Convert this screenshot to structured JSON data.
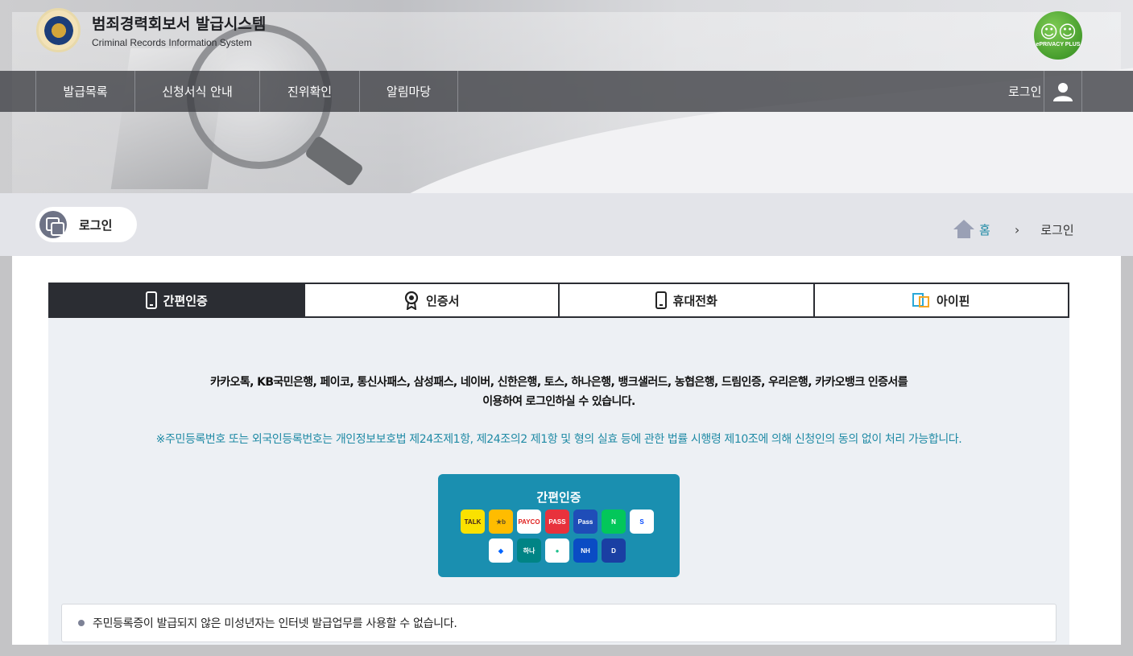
{
  "header": {
    "title": "범죄경력회보서 발급시스템",
    "subtitle": "Criminal Records Information System",
    "eprivacy_label": "ePRIVACY PLUS"
  },
  "nav": {
    "items": [
      {
        "label": "발급목록"
      },
      {
        "label": "신청서식 안내"
      },
      {
        "label": "진위확인"
      },
      {
        "label": "알림마당"
      }
    ],
    "login_label": "로그인"
  },
  "page": {
    "badge_label": "로그인",
    "breadcrumb": {
      "home": "홈",
      "current": "로그인"
    }
  },
  "tabs": [
    {
      "label": "간편인증",
      "icon": "phone-icon",
      "active": true
    },
    {
      "label": "인증서",
      "icon": "certificate-icon",
      "active": false
    },
    {
      "label": "휴대전화",
      "icon": "mobile-phone-icon",
      "active": false
    },
    {
      "label": "아이핀",
      "icon": "ipin-icon",
      "active": false
    }
  ],
  "content": {
    "desc_line1": "카카오톡, KB국민은행, 페이코, 통신사패스, 삼성패스, 네이버, 신한은행, 토스, 하나은행, 뱅크샐러드, 농협은행, 드림인증, 우리은행, 카카오뱅크 인증서를",
    "desc_line2": "이용하여 로그인하실 수 있습니다.",
    "notice": "※주민등록번호 또는 외국인등록번호는 개인정보보호법 제24조제1항, 제24조의2 제1항 및 형의 실효 등에 관한 법률 시행령 제10조에 의해 신청인의 동의 없이 처리 가능합니다.",
    "easy_auth_button": "간편인증",
    "providers_row1": [
      {
        "name": "kakaotalk-icon",
        "text": "TALK",
        "bg": "#fae100",
        "fg": "#3c1e1e"
      },
      {
        "name": "kb-bank-icon",
        "text": "★b",
        "bg": "#ffbc00",
        "fg": "#5a4a2a"
      },
      {
        "name": "payco-icon",
        "text": "PAYCO",
        "bg": "#ffffff",
        "fg": "#e0201f"
      },
      {
        "name": "pass-icon",
        "text": "PASS",
        "bg": "#e8323c",
        "fg": "#ffffff"
      },
      {
        "name": "samsung-pass-icon",
        "text": "Pass",
        "bg": "#1f4db8",
        "fg": "#ffffff"
      },
      {
        "name": "naver-icon",
        "text": "N",
        "bg": "#03c75a",
        "fg": "#ffffff"
      },
      {
        "name": "shinhan-bank-icon",
        "text": "S",
        "bg": "#ffffff",
        "fg": "#0046ff"
      }
    ],
    "providers_row2": [
      {
        "name": "toss-icon",
        "text": "◆",
        "bg": "#ffffff",
        "fg": "#0064ff"
      },
      {
        "name": "hana-bank-icon",
        "text": "하나",
        "bg": "#008485",
        "fg": "#ffffff"
      },
      {
        "name": "banksalad-icon",
        "text": "●",
        "bg": "#ffffff",
        "fg": "#1fc18e"
      },
      {
        "name": "nh-bank-icon",
        "text": "NH",
        "bg": "#0a4cc4",
        "fg": "#ffffff"
      },
      {
        "name": "dream-cert-icon",
        "text": "D",
        "bg": "#1a3fa3",
        "fg": "#ffffff"
      }
    ],
    "bottom_notice": "주민등록증이 발급되지 않은 미성년자는 인터넷 발급업무를 사용할 수 없습니다."
  }
}
